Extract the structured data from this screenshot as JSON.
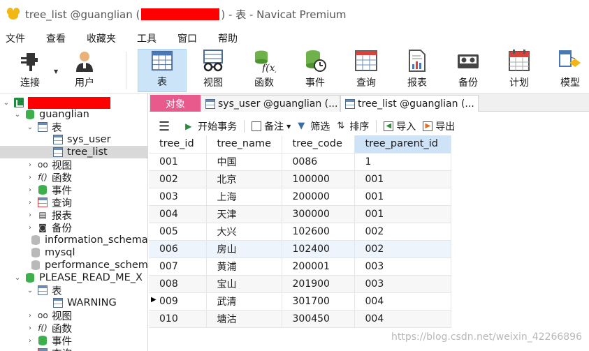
{
  "window": {
    "title_prefix": "tree_list @guanglian (",
    "title_suffix": ") - 表 - Navicat Premium"
  },
  "menu": [
    "文件",
    "查看",
    "收藏夹",
    "工具",
    "窗口",
    "帮助"
  ],
  "toolbar": {
    "connection": "连接",
    "user": "用户",
    "table": "表",
    "view": "视图",
    "function": "函数",
    "event": "事件",
    "query": "查询",
    "report": "报表",
    "backup": "备份",
    "schedule": "计划",
    "model": "模型"
  },
  "tree": {
    "db_guanglian": "guanglian",
    "tables": "表",
    "sys_user": "sys_user",
    "tree_list": "tree_list",
    "views": "视图",
    "functions": "函数",
    "events": "事件",
    "queries": "查询",
    "reports": "报表",
    "backups": "备份",
    "information_schema": "information_schema",
    "mysql": "mysql",
    "performance_schema": "performance_schema",
    "please_read_me": "PLEASE_READ_ME_X",
    "tables2": "表",
    "warning": "WARNING",
    "views2": "视图",
    "functions2": "函数",
    "events2": "事件",
    "queries2": "查询"
  },
  "tabs": {
    "objects": "对象",
    "sys_user_tab": "sys_user @guanglian (...",
    "tree_list_tab": "tree_list @guanglian (..."
  },
  "gridbar": {
    "begin_transaction": "开始事务",
    "memo": "备注",
    "filter": "筛选",
    "sort": "排序",
    "import": "导入",
    "export": "导出"
  },
  "grid": {
    "columns": [
      "tree_id",
      "tree_name",
      "tree_code",
      "tree_parent_id"
    ],
    "rows": [
      [
        "001",
        "中国",
        "0086",
        "1"
      ],
      [
        "002",
        "北京",
        "100000",
        "001"
      ],
      [
        "003",
        "上海",
        "200000",
        "001"
      ],
      [
        "004",
        "天津",
        "300000",
        "001"
      ],
      [
        "005",
        "大兴",
        "102600",
        "002"
      ],
      [
        "006",
        "房山",
        "102400",
        "002"
      ],
      [
        "007",
        "黄浦",
        "200001",
        "003"
      ],
      [
        "008",
        "宝山",
        "201900",
        "003"
      ],
      [
        "009",
        "武清",
        "301700",
        "004"
      ],
      [
        "010",
        "塘沽",
        "300450",
        "004"
      ]
    ]
  },
  "watermark": "https://blog.csdn.net/weixin_42266896",
  "colors": {
    "objects_tab": "#e85a8b",
    "redaction": "#ff0000",
    "active_tool": "#cce4f7"
  }
}
